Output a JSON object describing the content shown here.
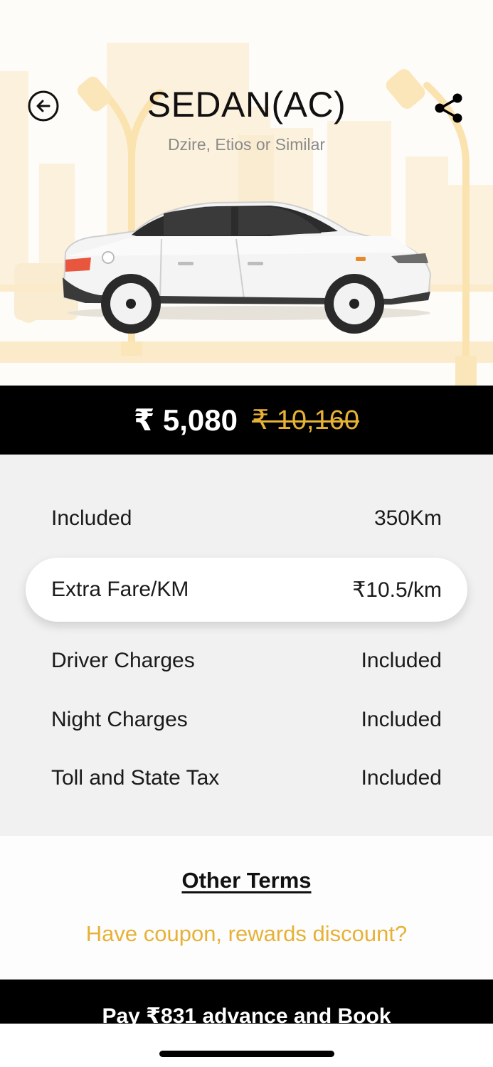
{
  "header": {
    "title": "SEDAN(AC)",
    "subtitle": "Dzire, Etios or Similar"
  },
  "icons": {
    "back": "back-arrow-circle-icon",
    "share": "share-icon"
  },
  "price": {
    "current": "₹ 5,080",
    "original": "₹ 10,160"
  },
  "details": {
    "rows": [
      {
        "label": "Included",
        "value": "350Km"
      },
      {
        "label": "Extra Fare/KM",
        "value": "₹10.5/km"
      },
      {
        "label": "Driver Charges",
        "value": "Included"
      },
      {
        "label": "Night Charges",
        "value": "Included"
      },
      {
        "label": "Toll and State Tax",
        "value": "Included"
      }
    ]
  },
  "links": {
    "other_terms": "Other Terms",
    "coupon": "Have coupon, rewards discount?"
  },
  "cta": {
    "book_label": "Pay ₹831 advance and Book"
  },
  "colors": {
    "accent": "#e7b135",
    "bar": "#000000",
    "details_bg": "#f1f1f1",
    "hero_illustration": "#fbeccb"
  }
}
